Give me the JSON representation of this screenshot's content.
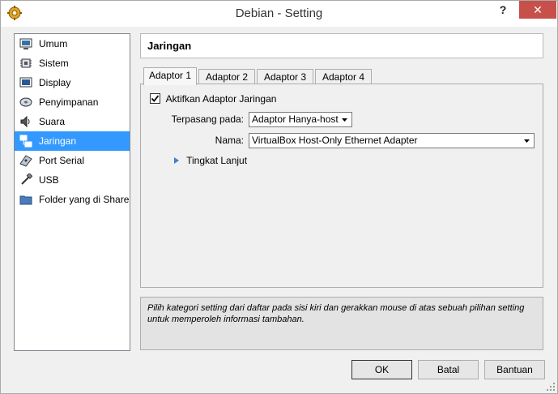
{
  "window": {
    "title": "Debian - Setting",
    "help_label": "?",
    "close_label": "✕"
  },
  "sidebar": {
    "items": [
      {
        "label": "Umum",
        "icon": "monitor-icon"
      },
      {
        "label": "Sistem",
        "icon": "chip-icon"
      },
      {
        "label": "Display",
        "icon": "display-icon"
      },
      {
        "label": "Penyimpanan",
        "icon": "disk-icon"
      },
      {
        "label": "Suara",
        "icon": "speaker-icon"
      },
      {
        "label": "Jaringan",
        "icon": "network-icon",
        "selected": true
      },
      {
        "label": "Port Serial",
        "icon": "serial-port-icon"
      },
      {
        "label": "USB",
        "icon": "usb-icon"
      },
      {
        "label": "Folder yang di Share",
        "icon": "folder-icon"
      }
    ]
  },
  "header": {
    "title": "Jaringan"
  },
  "tabs": [
    {
      "label": "Adaptor 1",
      "selected": true
    },
    {
      "label": "Adaptor 2"
    },
    {
      "label": "Adaptor 3"
    },
    {
      "label": "Adaptor 4"
    }
  ],
  "adapter": {
    "enable_label": "Aktifkan Adaptor Jaringan",
    "enabled": true,
    "attached_label": "Terpasang pada:",
    "attached_value": "Adaptor Hanya-host",
    "name_label": "Nama:",
    "name_value": "VirtualBox Host-Only Ethernet Adapter",
    "advanced_label": "Tingkat Lanjut"
  },
  "info": {
    "text": "Pilih kategori setting dari daftar pada sisi kiri dan gerakkan mouse di atas sebuah pilihan setting untuk memperoleh informasi tambahan."
  },
  "buttons": {
    "ok": "OK",
    "cancel": "Batal",
    "help": "Bantuan"
  },
  "colors": {
    "selection": "#3399ff",
    "close": "#c7504b"
  }
}
